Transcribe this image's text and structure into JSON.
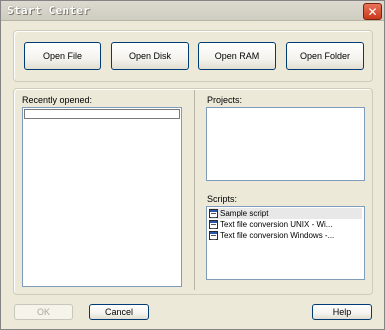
{
  "window": {
    "title": "Start Center",
    "close_label": "✕"
  },
  "open_buttons": {
    "open_file": "Open File",
    "open_disk": "Open Disk",
    "open_ram": "Open RAM",
    "open_folder": "Open Folder"
  },
  "recent": {
    "label": "Recently opened:",
    "items": [
      ""
    ]
  },
  "projects": {
    "label": "Projects:",
    "items": []
  },
  "scripts": {
    "label": "Scripts:",
    "items": [
      {
        "label": "Sample script",
        "icon": "script-icon",
        "selected": true
      },
      {
        "label": "Text file conversion UNIX - Wi...",
        "icon": "script-icon",
        "selected": false
      },
      {
        "label": "Text file conversion Windows -...",
        "icon": "script-icon",
        "selected": false
      }
    ]
  },
  "footer": {
    "ok_label": "OK",
    "ok_enabled": false,
    "cancel_label": "Cancel",
    "help_label": "Help"
  }
}
